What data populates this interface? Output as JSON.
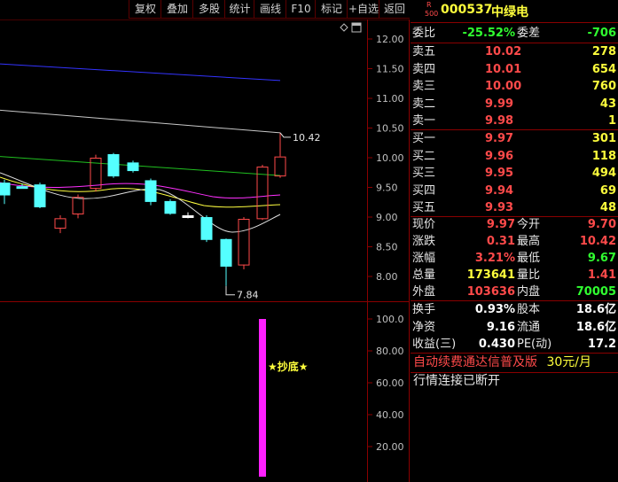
{
  "toolbar": {
    "buttons": [
      "复权",
      "叠加",
      "多股",
      "统计",
      "画线",
      "F10",
      "标记",
      "+自选",
      "返回"
    ]
  },
  "chart": {
    "price_axis": [
      "12.00",
      "11.50",
      "11.00",
      "10.50",
      "10.00",
      "9.50",
      "9.00",
      "8.50",
      "8.00"
    ],
    "indicator_axis": [
      "100.0",
      "80.00",
      "60.00",
      "40.00",
      "20.00"
    ],
    "high_label": "10.42",
    "low_label": "7.84",
    "signal_label": "★抄底★"
  },
  "chart_data": {
    "type": "candlestick",
    "ylim": [
      7.6,
      12.2
    ],
    "candles": [
      {
        "open": 9.38,
        "close": 9.58,
        "high": 9.63,
        "low": 9.22,
        "color": "cyan"
      },
      {
        "open": 9.5,
        "close": 9.52,
        "high": 9.56,
        "low": 9.48,
        "color": "cyan"
      },
      {
        "open": 9.55,
        "close": 9.18,
        "high": 9.58,
        "low": 9.15,
        "color": "cyan"
      },
      {
        "open": 8.98,
        "close": 8.82,
        "high": 9.03,
        "low": 8.73,
        "color": "red-hollow"
      },
      {
        "open": 9.06,
        "close": 9.34,
        "high": 9.38,
        "low": 8.98,
        "color": "red-hollow"
      },
      {
        "open": 9.49,
        "close": 10.0,
        "high": 10.05,
        "low": 9.43,
        "color": "red-hollow"
      },
      {
        "open": 10.06,
        "close": 9.7,
        "high": 10.08,
        "low": 9.66,
        "color": "cyan"
      },
      {
        "open": 9.92,
        "close": 9.79,
        "high": 9.95,
        "low": 9.75,
        "color": "cyan"
      },
      {
        "open": 9.62,
        "close": 9.27,
        "high": 9.65,
        "low": 9.2,
        "color": "cyan"
      },
      {
        "open": 9.27,
        "close": 9.07,
        "high": 9.3,
        "low": 9.04,
        "color": "cyan"
      },
      {
        "open": 9.03,
        "close": 9.03,
        "high": 9.08,
        "low": 8.98,
        "color": "white"
      },
      {
        "open": 9.0,
        "close": 8.63,
        "high": 9.03,
        "low": 8.58,
        "color": "cyan"
      },
      {
        "open": 8.63,
        "close": 8.18,
        "high": 8.64,
        "low": 7.84,
        "color": "cyan"
      },
      {
        "open": 8.2,
        "close": 8.97,
        "high": 9.0,
        "low": 8.12,
        "color": "red-hollow"
      },
      {
        "open": 8.98,
        "close": 9.85,
        "high": 9.88,
        "low": 8.95,
        "color": "red-hollow"
      },
      {
        "open": 9.7,
        "close": 10.02,
        "high": 10.42,
        "low": 9.66,
        "color": "red-hollow"
      }
    ],
    "ma_lines": [
      {
        "name": "blue",
        "color": "#3333ff",
        "from": 11.58,
        "to": 11.3
      },
      {
        "name": "gray",
        "color": "#c8c8c8",
        "from": 10.8,
        "to": 10.42
      },
      {
        "name": "green",
        "color": "#20c020",
        "from": 10.02,
        "to": 9.7
      }
    ],
    "indicator": {
      "bar_value": 100,
      "range": [
        0,
        108
      ]
    }
  },
  "quote": {
    "code": "000537",
    "name": "中绿电",
    "badge_top": "R",
    "badge_bottom": "500",
    "weibi_label": "委比",
    "weibi_value": "-25.52%",
    "weicha_label": "委差",
    "weicha_value": "-706",
    "asks": [
      {
        "label": "卖五",
        "price": "10.02",
        "vol": "278"
      },
      {
        "label": "卖四",
        "price": "10.01",
        "vol": "654"
      },
      {
        "label": "卖三",
        "price": "10.00",
        "vol": "760"
      },
      {
        "label": "卖二",
        "price": "9.99",
        "vol": "43"
      },
      {
        "label": "卖一",
        "price": "9.98",
        "vol": "1"
      }
    ],
    "bids": [
      {
        "label": "买一",
        "price": "9.97",
        "vol": "301"
      },
      {
        "label": "买二",
        "price": "9.96",
        "vol": "118"
      },
      {
        "label": "买三",
        "price": "9.95",
        "vol": "494"
      },
      {
        "label": "买四",
        "price": "9.94",
        "vol": "69"
      },
      {
        "label": "买五",
        "price": "9.93",
        "vol": "48"
      }
    ],
    "stats1": [
      {
        "l1": "现价",
        "v1": "9.97",
        "l2": "今开",
        "v2": "9.70"
      },
      {
        "l1": "涨跌",
        "v1": "0.31",
        "l2": "最高",
        "v2": "10.42"
      },
      {
        "l1": "涨幅",
        "v1": "3.21%",
        "l2": "最低",
        "v2": "9.67"
      },
      {
        "l1": "总量",
        "v1": "173641",
        "l2": "量比",
        "v2": "1.41"
      },
      {
        "l1": "外盘",
        "v1": "103636",
        "l2": "内盘",
        "v2": "70005"
      }
    ],
    "stats2": [
      {
        "l1": "换手",
        "v1": "0.93%",
        "l2": "股本",
        "v2": "18.6亿"
      },
      {
        "l1": "净资",
        "v1": "9.16",
        "l2": "流通",
        "v2": "18.6亿"
      },
      {
        "l1": "收益(三)",
        "v1": "0.430",
        "l2": "PE(动)",
        "v2": "17.2"
      }
    ],
    "ad_text": "自动续费通达信普及版",
    "ad_price": "30元/月",
    "status": "行情连接已断开"
  }
}
